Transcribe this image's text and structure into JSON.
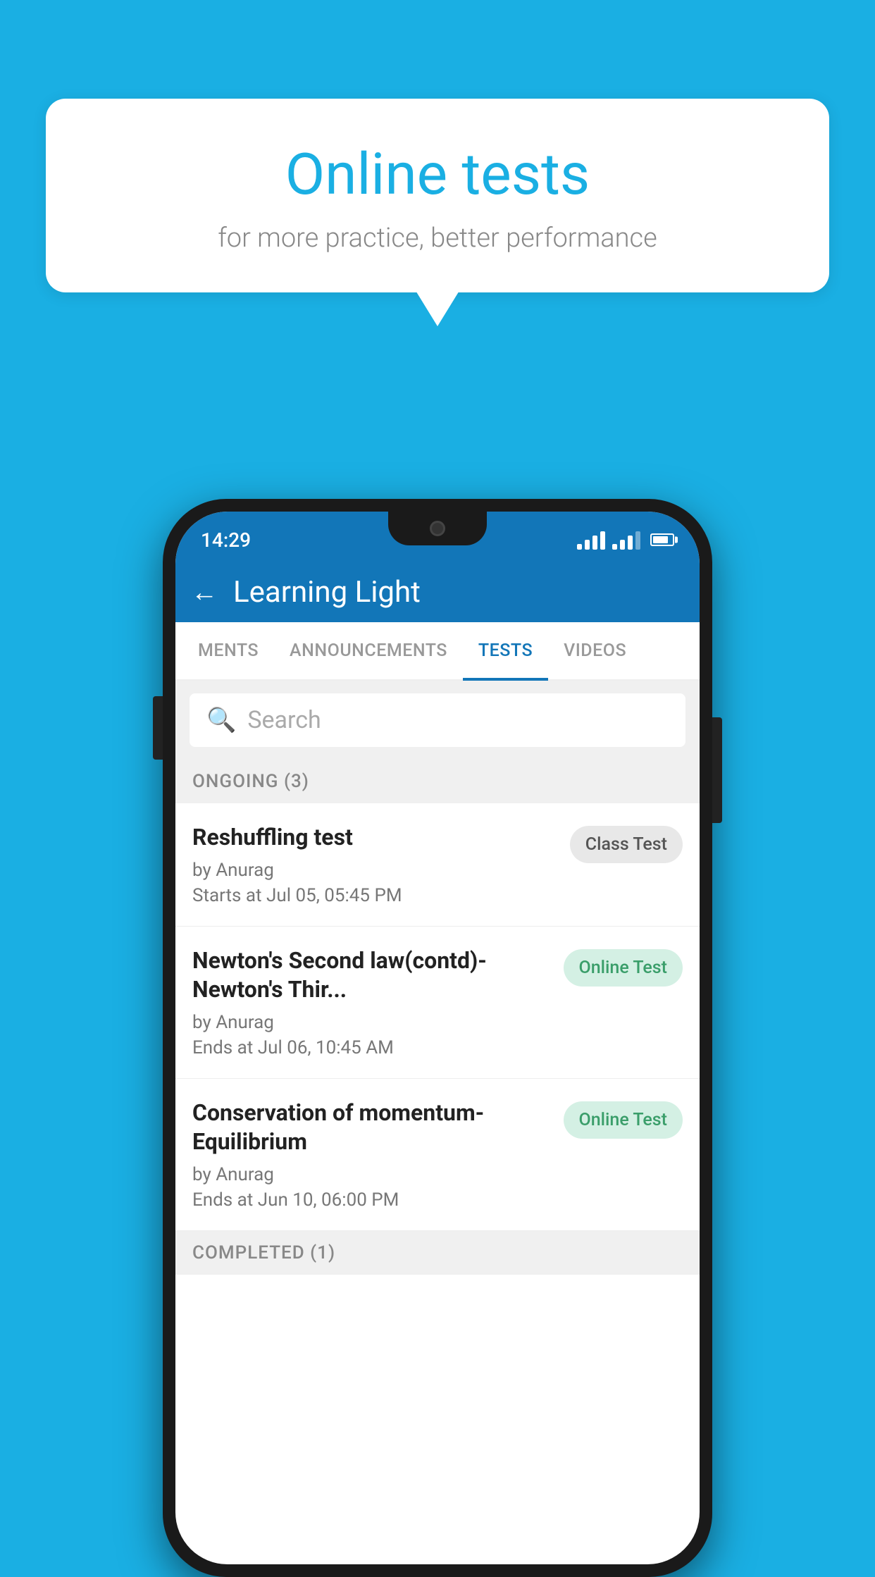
{
  "background": {
    "color": "#1AAFE3"
  },
  "speech_bubble": {
    "title": "Online tests",
    "subtitle": "for more practice, better performance"
  },
  "phone": {
    "status_bar": {
      "time": "14:29"
    },
    "header": {
      "back_label": "←",
      "title": "Learning Light"
    },
    "tabs": [
      {
        "label": "MENTS",
        "active": false
      },
      {
        "label": "ANNOUNCEMENTS",
        "active": false
      },
      {
        "label": "TESTS",
        "active": true
      },
      {
        "label": "VIDEOS",
        "active": false
      }
    ],
    "search": {
      "placeholder": "Search"
    },
    "ongoing_section": {
      "label": "ONGOING (3)"
    },
    "tests": [
      {
        "name": "Reshuffling test",
        "author": "by Anurag",
        "time_label": "Starts at",
        "time": "Jul 05, 05:45 PM",
        "badge": "Class Test",
        "badge_type": "class"
      },
      {
        "name": "Newton's Second law(contd)-Newton's Thir...",
        "author": "by Anurag",
        "time_label": "Ends at",
        "time": "Jul 06, 10:45 AM",
        "badge": "Online Test",
        "badge_type": "online"
      },
      {
        "name": "Conservation of momentum-Equilibrium",
        "author": "by Anurag",
        "time_label": "Ends at",
        "time": "Jun 10, 06:00 PM",
        "badge": "Online Test",
        "badge_type": "online"
      }
    ],
    "completed_section": {
      "label": "COMPLETED (1)"
    }
  }
}
